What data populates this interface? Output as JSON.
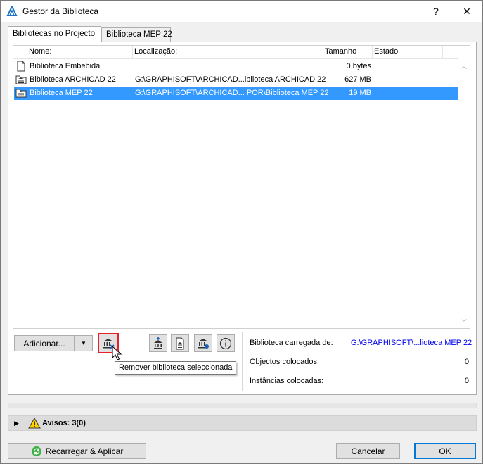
{
  "window": {
    "title": "Gestor da Biblioteca",
    "help_label": "?",
    "close_label": "✕"
  },
  "tabs": [
    {
      "label": "Bibliotecas no Projecto",
      "active": true
    },
    {
      "label": "Biblioteca MEP 22",
      "active": false
    }
  ],
  "list": {
    "columns": {
      "name": "Nome:",
      "location": "Localização:",
      "size": "Tamanho",
      "status": "Estado"
    },
    "rows": [
      {
        "name": "Biblioteca Embebida",
        "location": "",
        "size": "0 bytes",
        "status": "",
        "icon": "embedded-library-icon"
      },
      {
        "name": "Biblioteca ARCHICAD 22",
        "location": "G:\\GRAPHISOFT\\ARCHICAD...iblioteca ARCHICAD 22",
        "size": "627 MB",
        "status": "",
        "icon": "linked-library-icon"
      },
      {
        "name": "Biblioteca MEP 22",
        "location": "G:\\GRAPHISOFT\\ARCHICAD... POR\\Biblioteca MEP 22",
        "size": "19 MB",
        "status": "",
        "icon": "linked-library-icon",
        "selected": true
      }
    ]
  },
  "toolbar": {
    "add_label": "Adicionar...",
    "add_dropdown": "▼"
  },
  "tooltip": {
    "text": "Remover biblioteca seleccionada"
  },
  "info": {
    "loaded_label": "Biblioteca carregada de:",
    "loaded_path": "G:\\GRAPHISOFT\\...lioteca MEP 22",
    "objects_label": "Objectos colocados:",
    "objects_value": "0",
    "instances_label": "Instâncias colocadas:",
    "instances_value": "0"
  },
  "warnings": {
    "label": "Avisos: 3(0)"
  },
  "footer": {
    "reload_label": "Recarregar & Aplicar",
    "cancel_label": "Cancelar",
    "ok_label": "OK"
  },
  "colors": {
    "selection": "#3399ff",
    "accent": "#0078d7",
    "highlight": "#e8202a",
    "link": "#0000ee"
  }
}
